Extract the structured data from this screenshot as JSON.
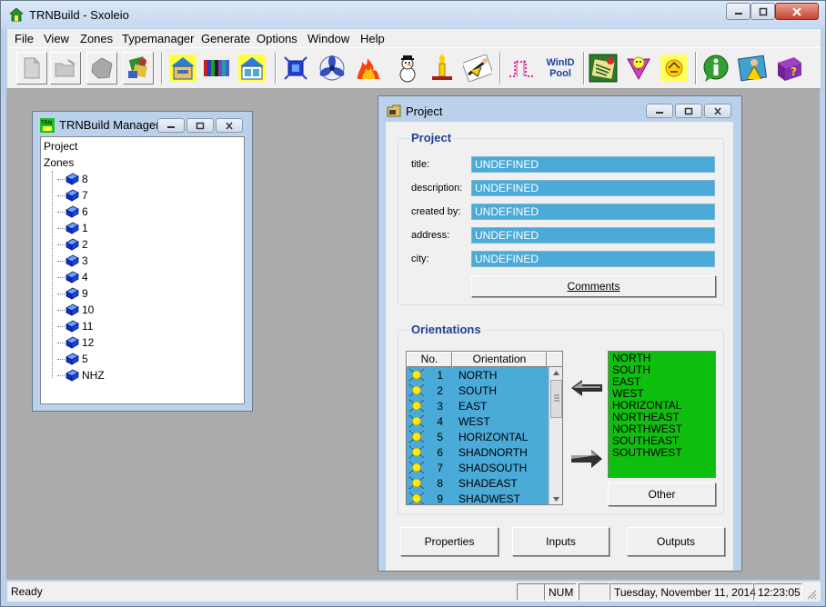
{
  "window": {
    "title": "TRNBuild - Sxoleio"
  },
  "menu": [
    "File",
    "View",
    "Zones",
    "Typemanager",
    "Generate",
    "Options",
    "Window",
    "Help"
  ],
  "toolbar": {
    "icons": [
      "new-document-icon",
      "open-file-icon",
      "save-icon",
      "print-icon",
      "building-icon",
      "wall-layers-icon",
      "window-house-icon",
      "geometry-icon",
      "ventilation-fan-icon",
      "heating-fire-icon",
      "cooling-snowman-icon",
      "gains-candle-icon",
      "comfort-person-icon",
      "schedule-icon",
      "library-icon",
      "hat-tool-icon",
      "sun-tool-icon",
      "info-icon",
      "map-person-icon",
      "help-book-icon"
    ],
    "winid_label_1": "WinID",
    "winid_label_2": "Pool"
  },
  "manager": {
    "title": "TRNBuild Manager",
    "root_project": "Project",
    "root_zones": "Zones",
    "zones": [
      "8",
      "7",
      "6",
      "1",
      "2",
      "3",
      "4",
      "9",
      "10",
      "11",
      "12",
      "5",
      "NHZ"
    ]
  },
  "project": {
    "title": "Project",
    "group_project": "Project",
    "fields": [
      {
        "label": "title:",
        "value": "UNDEFINED"
      },
      {
        "label": "description:",
        "value": "UNDEFINED"
      },
      {
        "label": "created by:",
        "value": "UNDEFINED"
      },
      {
        "label": "address:",
        "value": "UNDEFINED"
      },
      {
        "label": "city:",
        "value": "UNDEFINED"
      }
    ],
    "comments_button": "Comments",
    "group_orientations": "Orientations",
    "table_headers": [
      "No.",
      "Orientation"
    ],
    "orientations": [
      {
        "no": "1",
        "name": "NORTH"
      },
      {
        "no": "2",
        "name": "SOUTH"
      },
      {
        "no": "3",
        "name": "EAST"
      },
      {
        "no": "4",
        "name": "WEST"
      },
      {
        "no": "5",
        "name": "HORIZONTAL"
      },
      {
        "no": "6",
        "name": "SHADNORTH"
      },
      {
        "no": "7",
        "name": "SHADSOUTH"
      },
      {
        "no": "8",
        "name": "SHADEAST"
      },
      {
        "no": "9",
        "name": "SHADWEST"
      }
    ],
    "available": [
      "NORTH",
      "SOUTH",
      "EAST",
      "WEST",
      "HORIZONTAL",
      "NORTHEAST",
      "NORTHWEST",
      "SOUTHEAST",
      "SOUTHWEST"
    ],
    "other_button": "Other",
    "properties_button": "Properties",
    "inputs_button": "Inputs",
    "outputs_button": "Outputs"
  },
  "status": {
    "text": "Ready",
    "num": "NUM",
    "date": "Tuesday, November 11, 2014",
    "time": "12:23:05"
  },
  "colors": {
    "field_bg": "#4aaad8",
    "list_green": "#0fbf0f",
    "group_title": "#1e3f96"
  }
}
